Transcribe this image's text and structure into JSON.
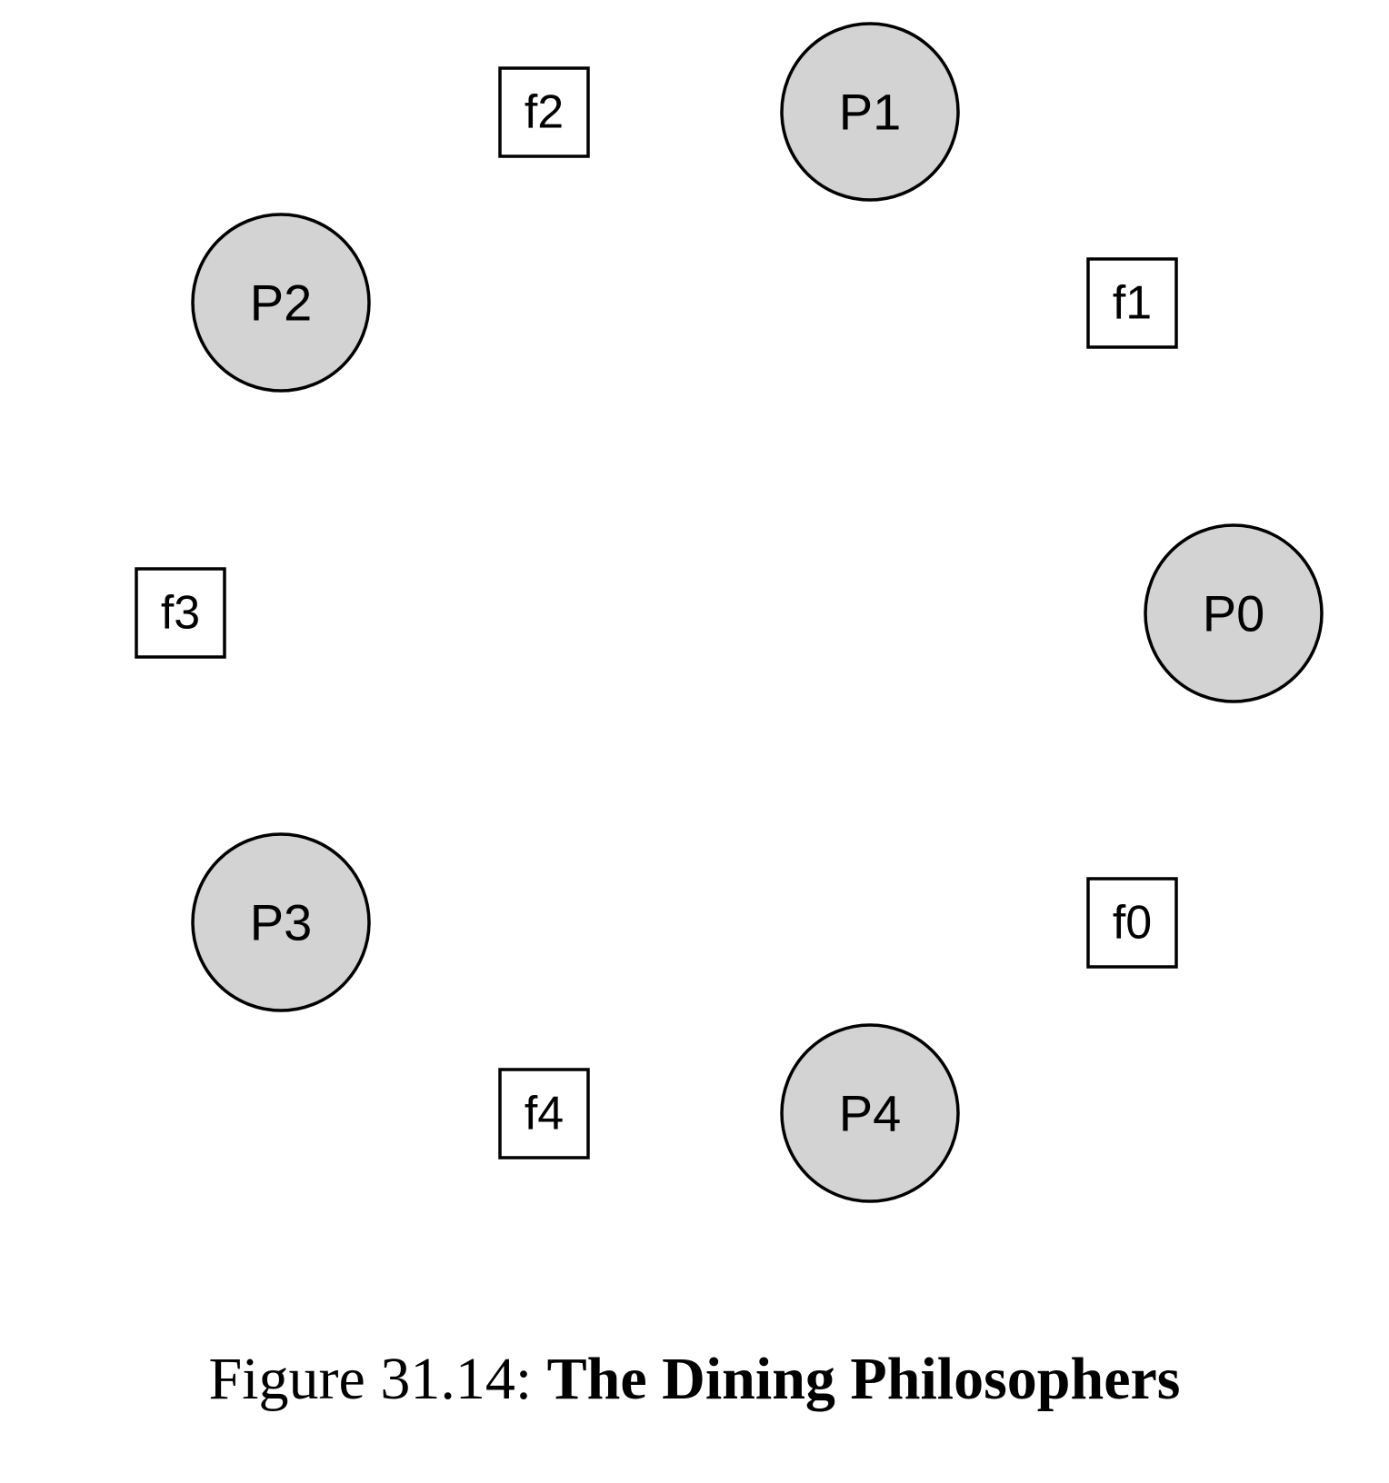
{
  "diagram": {
    "philosophers": [
      {
        "id": "p0",
        "label": "P0"
      },
      {
        "id": "p1",
        "label": "P1"
      },
      {
        "id": "p2",
        "label": "P2"
      },
      {
        "id": "p3",
        "label": "P3"
      },
      {
        "id": "p4",
        "label": "P4"
      }
    ],
    "forks": [
      {
        "id": "f0",
        "label": "f0"
      },
      {
        "id": "f1",
        "label": "f1"
      },
      {
        "id": "f2",
        "label": "f2"
      },
      {
        "id": "f3",
        "label": "f3"
      },
      {
        "id": "f4",
        "label": "f4"
      }
    ],
    "colors": {
      "philosopher_fill": "#d3d3d3",
      "fork_fill": "#ffffff",
      "stroke": "#000000"
    }
  },
  "caption": {
    "prefix": "Figure 31.14: ",
    "title": "The Dining Philosophers"
  }
}
